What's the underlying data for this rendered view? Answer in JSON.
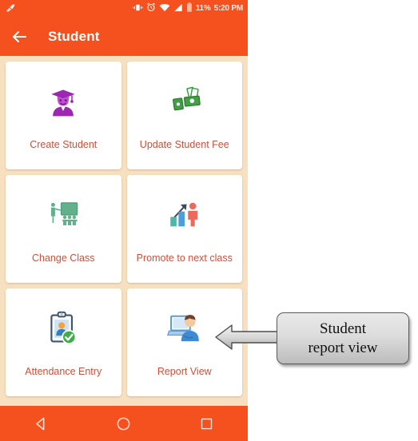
{
  "status_bar": {
    "left_icons": [
      {
        "name": "clean-master-icon",
        "glyph": "broom"
      }
    ],
    "right_icons": [
      {
        "name": "vibrate-icon",
        "glyph": "vibrate"
      },
      {
        "name": "alarm-icon",
        "glyph": "alarm"
      },
      {
        "name": "wifi-icon",
        "glyph": "wifi"
      },
      {
        "name": "signal-icon",
        "glyph": "signal"
      },
      {
        "name": "battery-icon",
        "glyph": "battery"
      }
    ],
    "battery_percent": "11%",
    "clock": "5:20 PM"
  },
  "app_bar": {
    "back_icon": "arrow-left-icon",
    "title": "Student"
  },
  "grid": {
    "tiles": [
      {
        "id": "create-student",
        "label": "Create Student",
        "icon": "graduate-student-icon"
      },
      {
        "id": "update-student-fee",
        "label": "Update Student Fee",
        "icon": "money-cash-icon"
      },
      {
        "id": "change-class",
        "label": "Change Class",
        "icon": "classroom-teacher-icon"
      },
      {
        "id": "promote-next-class",
        "label": "Promote to next class",
        "icon": "growth-chart-person-icon"
      },
      {
        "id": "attendance-entry",
        "label": "Attendance Entry",
        "icon": "clipboard-check-person-icon"
      },
      {
        "id": "report-view",
        "label": "Report View",
        "icon": "person-laptop-icon"
      }
    ]
  },
  "nav_bar": {
    "buttons": [
      {
        "id": "back",
        "icon": "triangle-back-icon"
      },
      {
        "id": "home",
        "icon": "circle-home-icon"
      },
      {
        "id": "recents",
        "icon": "square-recents-icon"
      }
    ]
  },
  "annotation": {
    "arrow_icon": "arrow-left-callout-icon",
    "text_line_1": "Student",
    "text_line_2": "report view"
  },
  "colors": {
    "accent_orange": "#f4511e",
    "page_background": "#f6e0c0",
    "tile_background": "#ffffff",
    "tile_label": "#c7523c",
    "status_text": "#ffe9df"
  }
}
